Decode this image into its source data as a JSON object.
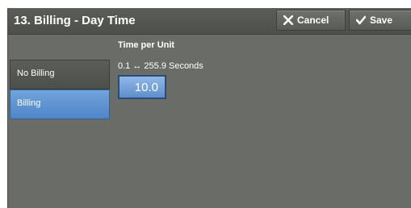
{
  "header": {
    "title": "13. Billing - Day Time",
    "cancel_label": "Cancel",
    "save_label": "Save"
  },
  "options": [
    {
      "label": "No Billing",
      "selected": false
    },
    {
      "label": "Billing",
      "selected": true
    }
  ],
  "time_per_unit": {
    "title": "Time per Unit",
    "range": "0.1 ↔ 255.9 Seconds",
    "value": "10.0"
  },
  "colors": {
    "background": "#6a6c67",
    "selected": "#5a8fd0",
    "header": "#545752"
  },
  "icons": {
    "cancel": "close-icon",
    "save": "checkmark-icon"
  }
}
